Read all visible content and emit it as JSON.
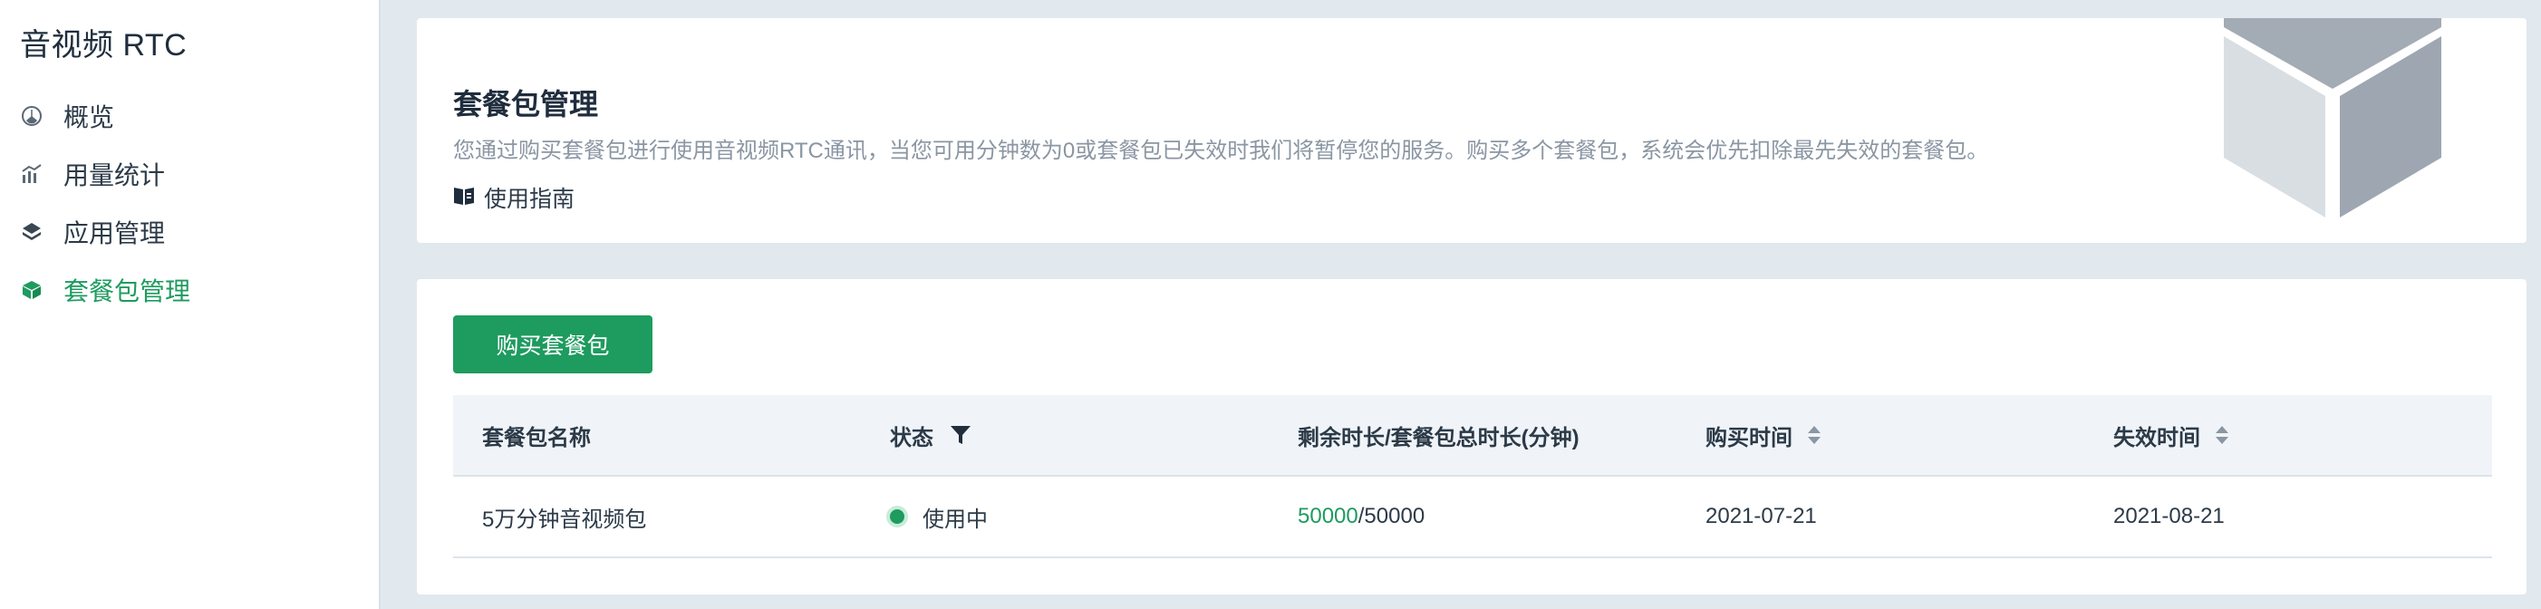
{
  "sidebar": {
    "app_title": "音视频 RTC",
    "items": [
      {
        "label": "概览",
        "icon": "dashboard-icon",
        "active": false
      },
      {
        "label": "用量统计",
        "icon": "bar-chart-icon",
        "active": false
      },
      {
        "label": "应用管理",
        "icon": "layers-icon",
        "active": false
      },
      {
        "label": "套餐包管理",
        "icon": "package-icon",
        "active": true
      }
    ]
  },
  "intro": {
    "title": "套餐包管理",
    "description": "您通过购买套餐包进行使用音视频RTC通讯，当您可用分钟数为0或套餐包已失效时我们将暂停您的服务。购买多个套餐包，系统会优先扣除最先失效的套餐包。",
    "guide_label": "使用指南",
    "guide_icon": "book-icon",
    "illustration": "cube-illustration"
  },
  "packages": {
    "buy_label": "购买套餐包",
    "columns": [
      "套餐包名称",
      "状态",
      "剩余时长/套餐包总时长(分钟)",
      "购买时间",
      "失效时间"
    ],
    "rows": [
      {
        "name": "5万分钟音视频包",
        "status": "使用中",
        "remaining": "50000",
        "separator": "/",
        "total": "50000",
        "purchase_date": "2021-07-21",
        "expire_date": "2021-08-21"
      }
    ]
  },
  "colors": {
    "accent": "#1e9b5f",
    "background": "#e1e8ee",
    "table_header": "#f0f4f8"
  }
}
